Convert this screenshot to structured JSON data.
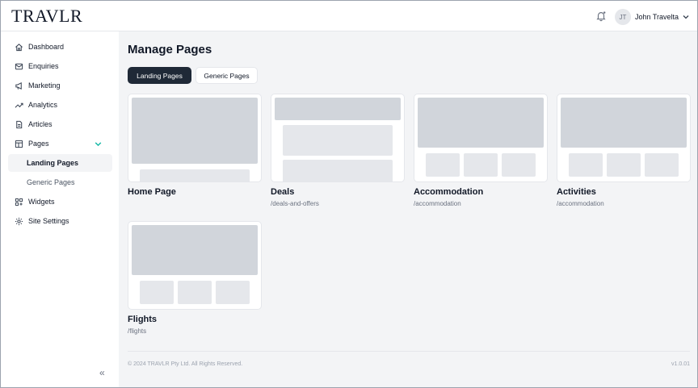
{
  "header": {
    "logo": "TRAVLR",
    "user_initials": "JT",
    "user_name": "John Travelta"
  },
  "sidebar": {
    "items": [
      {
        "label": "Dashboard",
        "icon": "home-icon"
      },
      {
        "label": "Enquiries",
        "icon": "mail-icon"
      },
      {
        "label": "Marketing",
        "icon": "megaphone-icon"
      },
      {
        "label": "Analytics",
        "icon": "trend-icon"
      },
      {
        "label": "Articles",
        "icon": "document-icon"
      },
      {
        "label": "Pages",
        "icon": "layout-icon"
      },
      {
        "label": "Landing Pages",
        "icon": ""
      },
      {
        "label": "Generic Pages",
        "icon": ""
      },
      {
        "label": "Widgets",
        "icon": "widgets-icon"
      },
      {
        "label": "Site Settings",
        "icon": "gear-icon"
      }
    ],
    "collapse_glyph": "«"
  },
  "main": {
    "title": "Manage Pages",
    "tabs": [
      {
        "label": "Landing Pages",
        "active": true
      },
      {
        "label": "Generic Pages",
        "active": false
      }
    ],
    "cards": [
      {
        "title": "Home Page",
        "path": ""
      },
      {
        "title": "Deals",
        "path": "/deals-and-offers"
      },
      {
        "title": "Accommodation",
        "path": "/accommodation"
      },
      {
        "title": "Activities",
        "path": "/accommodation"
      },
      {
        "title": "Flights",
        "path": "/flights"
      }
    ]
  },
  "footer": {
    "copyright": "© 2024 TRAVLR Pty Ltd. All Rights Reserved.",
    "version": "v1.0.01"
  },
  "colors": {
    "accent_dark": "#1f2937",
    "chevron_teal": "#14b8a6",
    "background": "#f3f4f6"
  }
}
